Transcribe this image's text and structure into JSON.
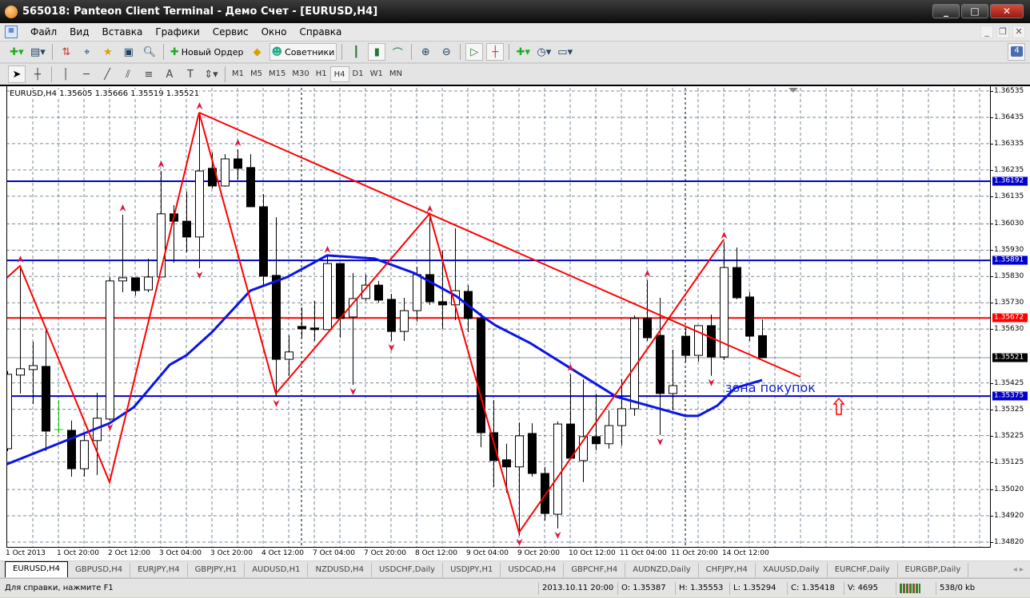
{
  "window": {
    "title": "565018: Panteon Client Terminal - Демо Счет - [EURUSD,H4]",
    "minimize": "_",
    "maximize": "□",
    "close": "✕"
  },
  "menu": [
    "Файл",
    "Вид",
    "Вставка",
    "Графики",
    "Сервис",
    "Окно",
    "Справка"
  ],
  "mdi": {
    "minimize": "_",
    "restore": "❐",
    "close": "✕"
  },
  "toolbar": {
    "new_order": "Новый Ордер",
    "experts": "Советники",
    "messages": "4"
  },
  "timeframes": [
    "M1",
    "M5",
    "M15",
    "M30",
    "H1",
    "H4",
    "D1",
    "W1",
    "MN"
  ],
  "active_timeframe": "H4",
  "chart": {
    "header": "EURUSD,H4  1.35605 1.35666 1.35519 1.35521",
    "annotation": "зона покупок"
  },
  "colors": {
    "blue_level": "#0000cc",
    "red_level": "#ff0000",
    "ma": "#0a14e6",
    "zigzag": "#ff0000",
    "fractal": "#dc143c",
    "last_price": "#000000"
  },
  "chart_data": {
    "type": "candlestick",
    "symbol": "EURUSD",
    "timeframe": "H4",
    "ylim": [
      1.3482,
      1.36535
    ],
    "price_ticks": [
      "1.36535",
      "1.36435",
      "1.36335",
      "1.36235",
      "1.36135",
      "1.36030",
      "1.35930",
      "1.35830",
      "1.35730",
      "1.35630",
      "1.35425",
      "1.35325",
      "1.35225",
      "1.35125",
      "1.35020",
      "1.34920",
      "1.34820"
    ],
    "time_labels": [
      "1 Oct 2013",
      "1 Oct 20:00",
      "2 Oct 12:00",
      "3 Oct 04:00",
      "3 Oct 20:00",
      "4 Oct 12:00",
      "7 Oct 04:00",
      "7 Oct 20:00",
      "8 Oct 12:00",
      "9 Oct 04:00",
      "9 Oct 20:00",
      "10 Oct 12:00",
      "11 Oct 04:00",
      "11 Oct 20:00",
      "14 Oct 12:00"
    ],
    "ohlc": [
      [
        1.35175,
        1.3547,
        1.35166,
        1.35458
      ],
      [
        1.35455,
        1.3587,
        1.35385,
        1.35479
      ],
      [
        1.35476,
        1.35582,
        1.35345,
        1.35491
      ],
      [
        1.35488,
        1.35631,
        1.35166,
        1.35242
      ],
      [
        1.35248,
        1.3536,
        1.35233,
        1.35248
      ],
      [
        1.35245,
        1.35282,
        1.35069,
        1.35099
      ],
      [
        1.35099,
        1.35236,
        1.35069,
        1.35206
      ],
      [
        1.35206,
        1.35388,
        1.35075,
        1.35291
      ],
      [
        1.35288,
        1.35828,
        1.35282,
        1.35813
      ],
      [
        1.35813,
        1.36065,
        1.3577,
        1.35825
      ],
      [
        1.35825,
        1.35825,
        1.35758,
        1.35776
      ],
      [
        1.35779,
        1.35898,
        1.3577,
        1.35828
      ],
      [
        1.35828,
        1.36231,
        1.35828,
        1.36068
      ],
      [
        1.36068,
        1.36101,
        1.35882,
        1.3604
      ],
      [
        1.3604,
        1.36153,
        1.35922,
        1.3598
      ],
      [
        1.3598,
        1.36453,
        1.35861,
        1.36231
      ],
      [
        1.36241,
        1.36301,
        1.36165,
        1.36174
      ],
      [
        1.36174,
        1.36295,
        1.36171,
        1.36277
      ],
      [
        1.36277,
        1.36313,
        1.36198,
        1.36241
      ],
      [
        1.36244,
        1.36295,
        1.36095,
        1.36095
      ],
      [
        1.36095,
        1.36143,
        1.35797,
        1.35831
      ],
      [
        1.35834,
        1.36055,
        1.35373,
        1.35515
      ],
      [
        1.35515,
        1.35606,
        1.35452,
        1.35543
      ],
      [
        1.3564,
        1.35713,
        1.35597,
        1.35631
      ],
      [
        1.35634,
        1.35737,
        1.35585,
        1.35628
      ],
      [
        1.35628,
        1.35907,
        1.35628,
        1.35879
      ],
      [
        1.35879,
        1.35879,
        1.35597,
        1.3567
      ],
      [
        1.35676,
        1.35843,
        1.35418,
        1.35746
      ],
      [
        1.35746,
        1.35837,
        1.35737,
        1.35797
      ],
      [
        1.35797,
        1.35813,
        1.35731,
        1.3574
      ],
      [
        1.35743,
        1.35764,
        1.35585,
        1.35621
      ],
      [
        1.35621,
        1.35749,
        1.35585,
        1.357
      ],
      [
        1.357,
        1.35867,
        1.35658,
        1.35837
      ],
      [
        1.35837,
        1.36062,
        1.35722,
        1.35734
      ],
      [
        1.35734,
        1.35928,
        1.35631,
        1.35722
      ],
      [
        1.35722,
        1.36013,
        1.35664,
        1.35776
      ],
      [
        1.35773,
        1.35797,
        1.35618,
        1.3567
      ],
      [
        1.3567,
        1.35691,
        1.35181,
        1.35236
      ],
      [
        1.35236,
        1.3536,
        1.3503,
        1.3513
      ],
      [
        1.35133,
        1.35194,
        1.35008,
        1.35106
      ],
      [
        1.35106,
        1.35275,
        1.34845,
        1.35224
      ],
      [
        1.35233,
        1.35272,
        1.35069,
        1.35081
      ],
      [
        1.35081,
        1.35106,
        1.34902,
        1.34929
      ],
      [
        1.34926,
        1.35279,
        1.34872,
        1.35269
      ],
      [
        1.35269,
        1.35458,
        1.35139,
        1.35139
      ],
      [
        1.3513,
        1.35439,
        1.35048,
        1.35221
      ],
      [
        1.35221,
        1.35385,
        1.35169,
        1.35194
      ],
      [
        1.35194,
        1.35321,
        1.35175,
        1.35263
      ],
      [
        1.35263,
        1.35439,
        1.35187,
        1.35327
      ],
      [
        1.35327,
        1.35682,
        1.353,
        1.3567
      ],
      [
        1.3567,
        1.35816,
        1.35585,
        1.35597
      ],
      [
        1.35606,
        1.35749,
        1.35227,
        1.35385
      ],
      [
        1.35385,
        1.35552,
        1.35321,
        1.35415
      ],
      [
        1.35603,
        1.35631,
        1.35506,
        1.3553
      ],
      [
        1.3553,
        1.35643,
        1.35506,
        1.35643
      ],
      [
        1.35643,
        1.35685,
        1.35452,
        1.35524
      ],
      [
        1.35524,
        1.35961,
        1.35512,
        1.35864
      ],
      [
        1.35864,
        1.3594,
        1.35743,
        1.35749
      ],
      [
        1.35752,
        1.3577,
        1.35585,
        1.35603
      ],
      [
        1.35605,
        1.35666,
        1.35519,
        1.35521
      ]
    ],
    "highlight_candle": {
      "index": 4,
      "color": "#00cc00"
    },
    "moving_average": [
      [
        -0.1,
        1.35115
      ],
      [
        8,
        1.35272
      ],
      [
        9.9,
        1.35333
      ],
      [
        12.7,
        1.35494
      ],
      [
        14,
        1.3553
      ],
      [
        16,
        1.35618
      ],
      [
        19,
        1.35776
      ],
      [
        21.9,
        1.35828
      ],
      [
        25,
        1.3591
      ],
      [
        28.7,
        1.35898
      ],
      [
        31.8,
        1.35843
      ],
      [
        35.1,
        1.35755
      ],
      [
        37.2,
        1.35676
      ],
      [
        38.2,
        1.35643
      ],
      [
        40.9,
        1.35576
      ],
      [
        43.9,
        1.35485
      ],
      [
        47.6,
        1.35373
      ],
      [
        53,
        1.353
      ],
      [
        54,
        1.353
      ],
      [
        55.5,
        1.35339
      ],
      [
        56.9,
        1.35406
      ],
      [
        59,
        1.35436
      ]
    ],
    "zigzag": [
      [
        -0.1,
        1.35822
      ],
      [
        1,
        1.3587
      ],
      [
        8,
        1.35048
      ],
      [
        15,
        1.36453
      ],
      [
        21,
        1.35385
      ],
      [
        33,
        1.36068
      ],
      [
        40,
        1.34857
      ],
      [
        56,
        1.3597
      ]
    ],
    "trendline": [
      [
        15,
        1.36453
      ],
      [
        62,
        1.35448
      ]
    ],
    "fractals_up": [
      1,
      9,
      12,
      15,
      18,
      25,
      33,
      44,
      50,
      56
    ],
    "fractals_down": [
      8,
      15,
      21,
      27,
      30,
      40,
      43,
      51,
      55
    ],
    "hlines": [
      {
        "price": "1.36192",
        "color": "#0000cc"
      },
      {
        "price": "1.35891",
        "color": "#0000cc"
      },
      {
        "price": "1.35672",
        "color": "#ff0000"
      },
      {
        "price": "1.35375",
        "color": "#0000cc"
      }
    ],
    "last_price": "1.35521",
    "period_separators": [
      23,
      53
    ],
    "buy_arrow": [
      65,
      1.3533
    ]
  },
  "tabs": [
    "EURUSD,H4",
    "GBPUSD,H4",
    "EURJPY,H4",
    "GBPJPY,H1",
    "AUDUSD,H1",
    "NZDUSD,H4",
    "USDCHF,Daily",
    "USDJPY,H1",
    "USDCAD,H4",
    "GBPCHF,H4",
    "AUDNZD,Daily",
    "CHFJPY,H4",
    "XAUUSD,Daily",
    "EURCHF,Daily",
    "EURGBP,Daily"
  ],
  "tab_nav": "◂ ▸",
  "status": {
    "help": "Для справки, нажмите F1",
    "time": "2013.10.11 20:00",
    "open": "O: 1.35387",
    "high": "H: 1.35553",
    "low": "L: 1.35294",
    "close": "C: 1.35418",
    "volume": "V: 4695",
    "traffic": "538/0 kb"
  }
}
